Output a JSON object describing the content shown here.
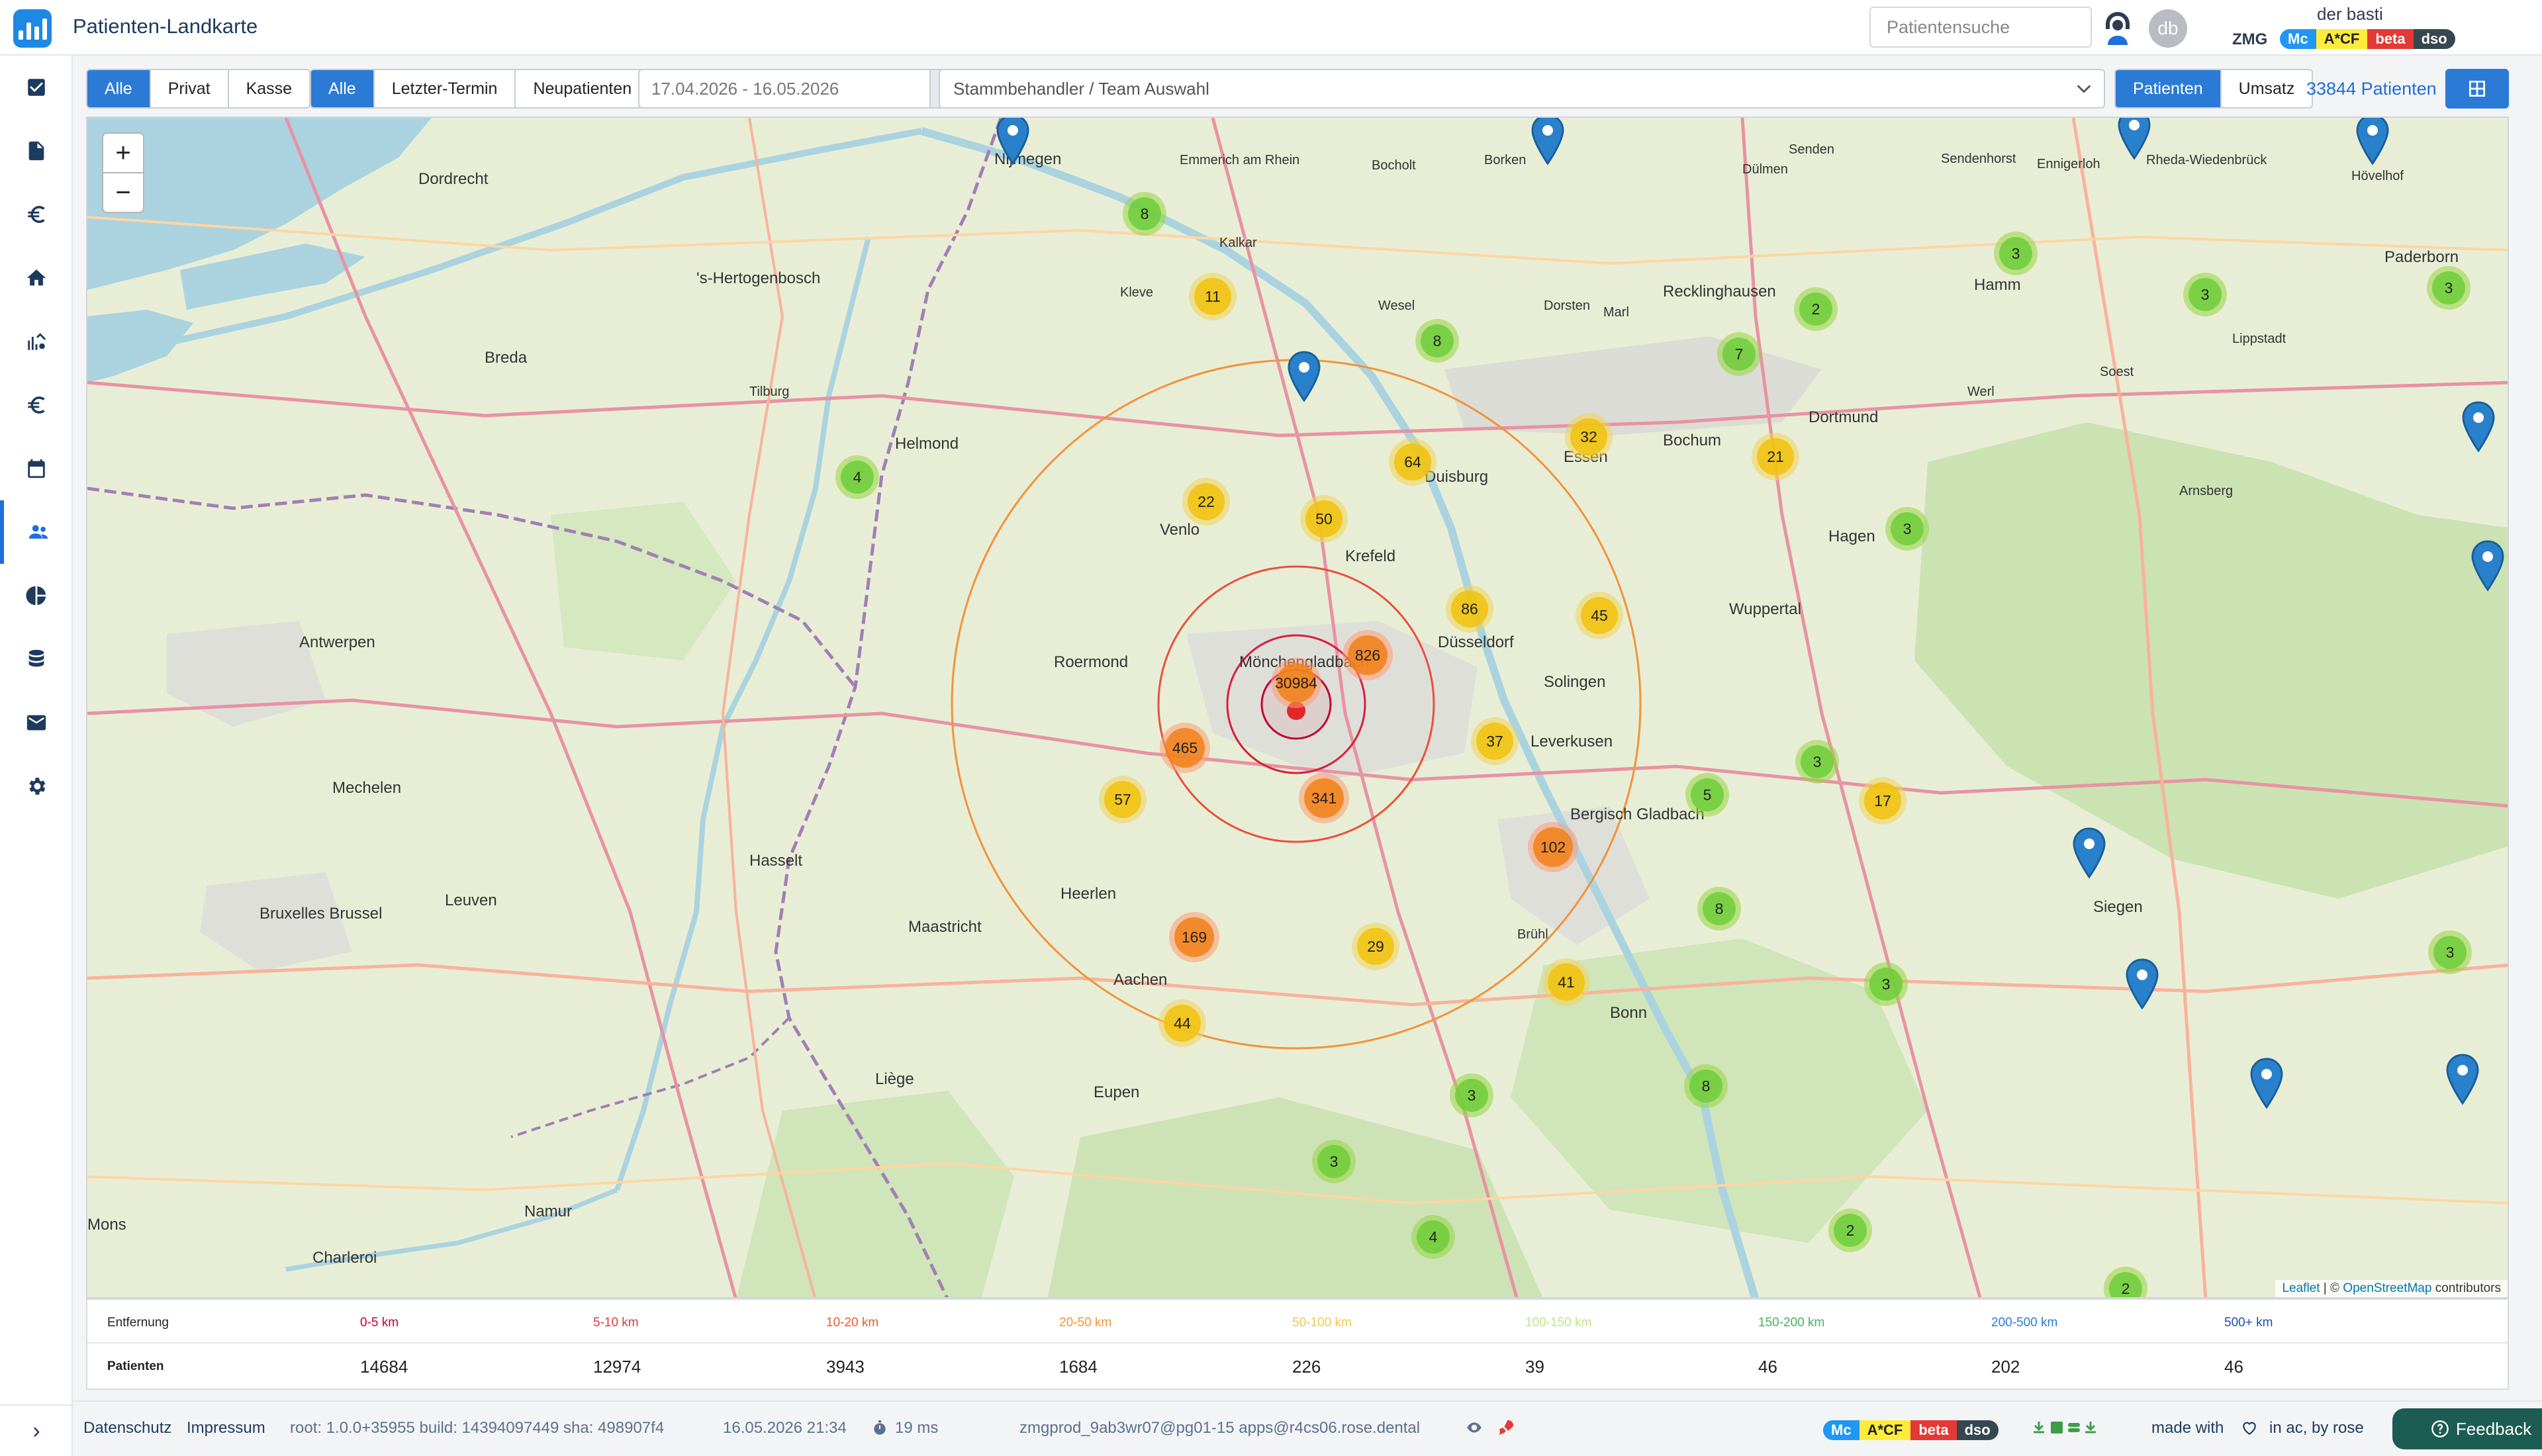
{
  "app": {
    "title": "Patienten-Landkarte"
  },
  "header": {
    "search_placeholder": "Patientensuche",
    "avatar_initials": "db",
    "user_name": "der basti",
    "org": "ZMG",
    "tags": [
      "Mc",
      "A*CF",
      "beta",
      "dso"
    ]
  },
  "filters": {
    "insurance": [
      "Alle",
      "Privat",
      "Kasse"
    ],
    "insurance_selected": "Alle",
    "patient_type": [
      "Alle",
      "Letzter-Termin",
      "Neupatienten"
    ],
    "patient_type_selected": "Alle",
    "date_range": "17.04.2026 - 16.05.2026",
    "team_placeholder": "Stammbehandler / Team Auswahl",
    "view_modes": [
      "Patienten",
      "Umsatz"
    ],
    "view_selected": "Patienten",
    "patient_count": "33844 Patienten"
  },
  "map": {
    "zoom_in": "+",
    "zoom_out": "−",
    "attribution_leaflet": "Leaflet",
    "attribution_osm": "OpenStreetMap",
    "attribution_suffix": "contributors",
    "place_labels": [
      "Dordrecht",
      "Nijmegen",
      "Emmerich am Rhein",
      "Bocholt",
      "Borken",
      "Dülmen",
      "Senden",
      "Sendenhorst",
      "Ennigerloh",
      "Rheda-Wiedenbrück",
      "Hövelhof",
      "Paderborn",
      "'s-Hertogenbosch",
      "Kleve",
      "Kalkar",
      "Wesel",
      "Dorsten",
      "Marl",
      "Recklinghausen",
      "Hamm",
      "Helmond",
      "Venlo",
      "Krefeld",
      "Duisburg",
      "Essen",
      "Bochum",
      "Dortmund",
      "Hagen",
      "Mönchengladbach",
      "Düsseldorf",
      "Wuppertal",
      "Solingen",
      "Roermond",
      "Antwerpen",
      "Mechelen",
      "Leverkusen",
      "Bergisch Gladbach",
      "Heerlen",
      "Maastricht",
      "Aachen",
      "Bonn",
      "Siegen",
      "Bruxelles Brussel",
      "Leuven",
      "Hasselt",
      "Liège",
      "Eupen",
      "Namur",
      "Charleroi",
      "Mons",
      "Brühl",
      "Arnsberg",
      "Werl",
      "Soest",
      "Lippstadt",
      "Breda",
      "Tilburg"
    ],
    "clusters": [
      {
        "count": "30984",
        "color": "orange"
      },
      {
        "count": "826",
        "color": "orange"
      },
      {
        "count": "465",
        "color": "orange"
      },
      {
        "count": "341",
        "color": "orange"
      },
      {
        "count": "169",
        "color": "orange"
      },
      {
        "count": "102",
        "color": "orange"
      },
      {
        "count": "86",
        "color": "yellow"
      },
      {
        "count": "64",
        "color": "yellow"
      },
      {
        "count": "57",
        "color": "yellow"
      },
      {
        "count": "50",
        "color": "yellow"
      },
      {
        "count": "45",
        "color": "yellow"
      },
      {
        "count": "44",
        "color": "yellow"
      },
      {
        "count": "41",
        "color": "yellow"
      },
      {
        "count": "37",
        "color": "yellow"
      },
      {
        "count": "32",
        "color": "yellow"
      },
      {
        "count": "29",
        "color": "yellow"
      },
      {
        "count": "22",
        "color": "yellow"
      },
      {
        "count": "21",
        "color": "yellow"
      },
      {
        "count": "17",
        "color": "yellow"
      },
      {
        "count": "11",
        "color": "yellow"
      },
      {
        "count": "8",
        "color": "green"
      },
      {
        "count": "8",
        "color": "green"
      },
      {
        "count": "8",
        "color": "green"
      },
      {
        "count": "8",
        "color": "green"
      },
      {
        "count": "7",
        "color": "green"
      },
      {
        "count": "5",
        "color": "green"
      },
      {
        "count": "4",
        "color": "green"
      },
      {
        "count": "4",
        "color": "green"
      },
      {
        "count": "3",
        "color": "green"
      },
      {
        "count": "3",
        "color": "green"
      },
      {
        "count": "3",
        "color": "green"
      },
      {
        "count": "3",
        "color": "green"
      },
      {
        "count": "3",
        "color": "green"
      },
      {
        "count": "3",
        "color": "green"
      },
      {
        "count": "3",
        "color": "green"
      },
      {
        "count": "3",
        "color": "green"
      },
      {
        "count": "3",
        "color": "green"
      },
      {
        "count": "2",
        "color": "green"
      },
      {
        "count": "2",
        "color": "green"
      },
      {
        "count": "2",
        "color": "green"
      }
    ]
  },
  "distance_table": {
    "header_label": "Entfernung",
    "value_label": "Patienten",
    "ranges": [
      {
        "label": "0-5 km",
        "color": "#c3002f",
        "patients": "14684"
      },
      {
        "label": "5-10 km",
        "color": "#e03a3a",
        "patients": "12974"
      },
      {
        "label": "10-20 km",
        "color": "#ef5a2a",
        "patients": "3943"
      },
      {
        "label": "20-50 km",
        "color": "#f59332",
        "patients": "1684"
      },
      {
        "label": "50-100 km",
        "color": "#f2c84b",
        "patients": "226"
      },
      {
        "label": "100-150 km",
        "color": "#b8e986",
        "patients": "39"
      },
      {
        "label": "150-200 km",
        "color": "#3fb55f",
        "patients": "46"
      },
      {
        "label": "200-500 km",
        "color": "#2b7bd6",
        "patients": "202"
      },
      {
        "label": "500+ km",
        "color": "#1e4fb0",
        "patients": "46"
      }
    ]
  },
  "footer": {
    "privacy": "Datenschutz",
    "imprint": "Impressum",
    "build": "root: 1.0.0+35955 build: 14394097449 sha: 498907f4",
    "timestamp": "16.05.2026 21:34",
    "latency": "19 ms",
    "connection": "zmgprod_9ab3wr07@pg01-15 apps@r4cs06.rose.dental",
    "made_with": "made with",
    "made_by": "in ac, by rose",
    "feedback": "Feedback"
  },
  "colors": {
    "primary": "#2b7bd6",
    "title": "#1d3a5f",
    "feedback": "#1d5c52"
  }
}
